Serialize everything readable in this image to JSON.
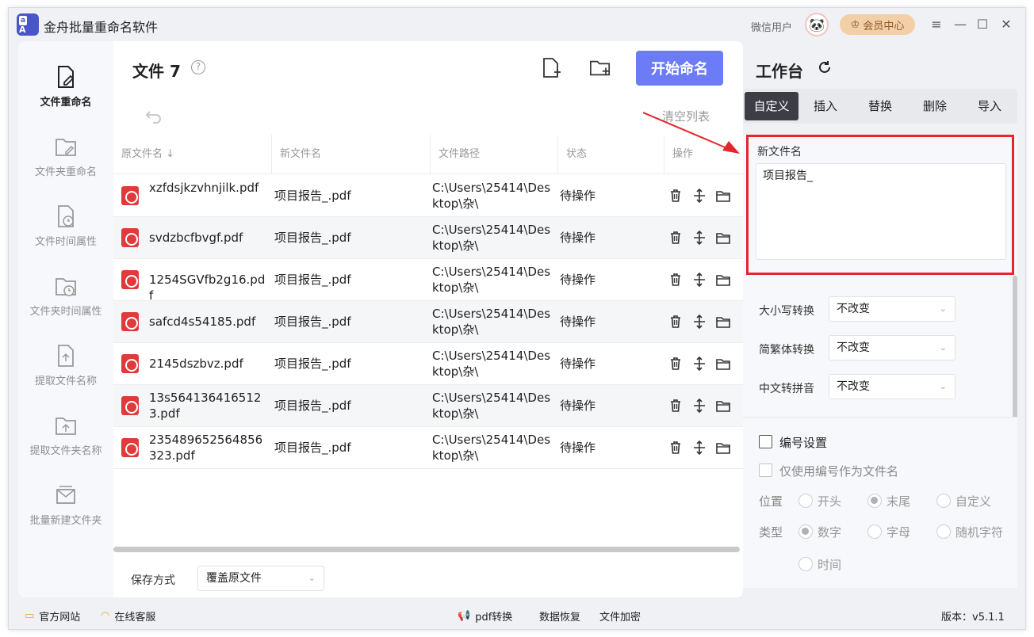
{
  "app": {
    "title": "金舟批量重命名软件",
    "user": "微信用户",
    "vip_label": "会员中心"
  },
  "sidebar": {
    "items": [
      {
        "label": "文件重命名",
        "icon": "file-edit-icon"
      },
      {
        "label": "文件夹重命名",
        "icon": "folder-edit-icon"
      },
      {
        "label": "文件时间属性",
        "icon": "file-clock-icon"
      },
      {
        "label": "文件夹时间属性",
        "icon": "folder-clock-icon"
      },
      {
        "label": "提取文件名称",
        "icon": "file-upload-icon"
      },
      {
        "label": "提取文件夹名称",
        "icon": "folder-upload-icon"
      },
      {
        "label": "批量新建文件夹",
        "icon": "batch-folder-icon"
      }
    ]
  },
  "files": {
    "title": "文件 7",
    "start_label": "开始命名",
    "clear_label": "清空列表",
    "columns": [
      "原文件名",
      "新文件名",
      "文件路径",
      "状态",
      "操作"
    ],
    "rows": [
      {
        "orig": "xzfdsjkzvhnjilk.pdf",
        "new": "项目报告_.pdf",
        "path": "C:\\Users\\25414\\Desktop\\杂\\",
        "status": "待操作"
      },
      {
        "orig": "svdzbcfbvgf.pdf",
        "new": "项目报告_.pdf",
        "path": "C:\\Users\\25414\\Desktop\\杂\\",
        "status": "待操作"
      },
      {
        "orig": "1254SGVfb2g16.pdf",
        "new": "项目报告_.pdf",
        "path": "C:\\Users\\25414\\Desktop\\杂\\",
        "status": "待操作"
      },
      {
        "orig": "safcd4s54185.pdf",
        "new": "项目报告_.pdf",
        "path": "C:\\Users\\25414\\Desktop\\杂\\",
        "status": "待操作"
      },
      {
        "orig": "2145dszbvz.pdf",
        "new": "项目报告_.pdf",
        "path": "C:\\Users\\25414\\Desktop\\杂\\",
        "status": "待操作"
      },
      {
        "orig": "13s5641364165123.pdf",
        "new": "项目报告_.pdf",
        "path": "C:\\Users\\25414\\Desktop\\杂\\",
        "status": "待操作"
      },
      {
        "orig": "235489652564856323.pdf",
        "new": "项目报告_.pdf",
        "path": "C:\\Users\\25414\\Desktop\\杂\\",
        "status": "待操作"
      }
    ],
    "save_label": "保存方式",
    "save_value": "覆盖原文件"
  },
  "workbench": {
    "title": "工作台",
    "tabs": [
      "自定义",
      "插入",
      "替换",
      "删除",
      "导入"
    ],
    "new_name_label": "新文件名",
    "new_name_value": "项目报告_",
    "options": [
      {
        "label": "大小写转换",
        "value": "不改变"
      },
      {
        "label": "简繁体转换",
        "value": "不改变"
      },
      {
        "label": "中文转拼音",
        "value": "不改变"
      }
    ],
    "numbering": {
      "enable_label": "编号设置",
      "only_number_label": "仅使用编号作为文件名",
      "position_label": "位置",
      "position_options": [
        "开头",
        "末尾",
        "自定义"
      ],
      "type_label": "类型",
      "type_options": [
        "数字",
        "字母",
        "随机字符",
        "时间"
      ]
    }
  },
  "statusbar": {
    "website": "官方网站",
    "service": "在线客服",
    "pdf": "pdf转换",
    "recovery": "数据恢复",
    "encrypt": "文件加密",
    "version": "版本：v5.1.1"
  },
  "colors": {
    "accent": "#6b7cf6",
    "highlight": "#e5262b",
    "pdf": "#e03a3a",
    "vip": "#f3cfa7"
  }
}
